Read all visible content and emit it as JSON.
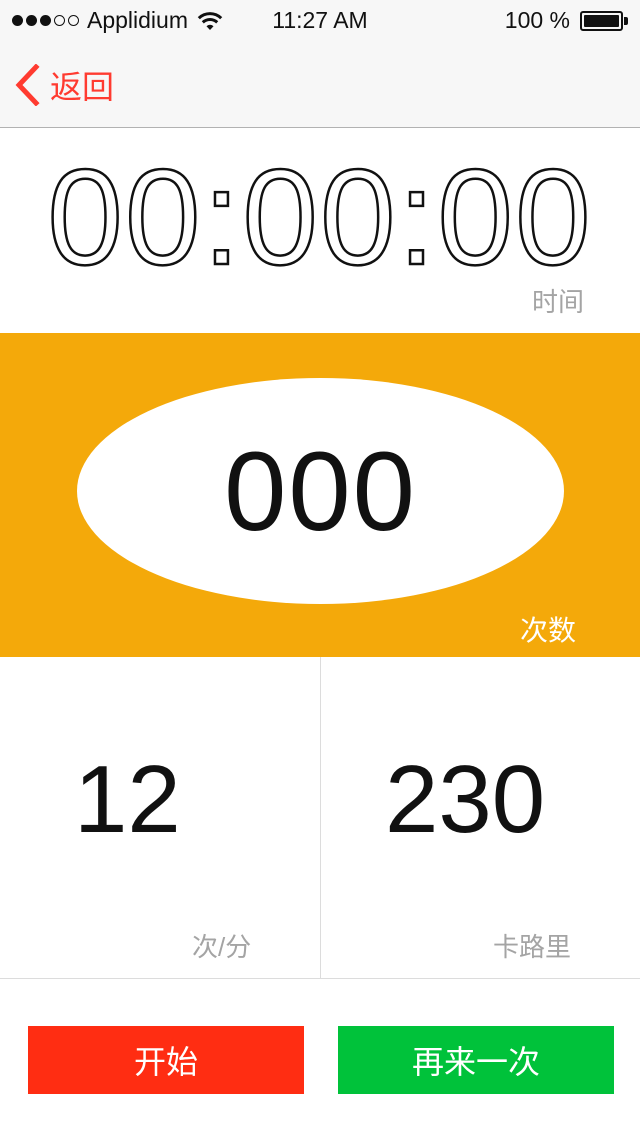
{
  "status_bar": {
    "carrier": "Applidium",
    "time": "11:27 AM",
    "battery": "100 %",
    "signal_strength": "3 of 5",
    "icons": [
      "signal-dots",
      "wifi-icon",
      "battery-icon"
    ]
  },
  "nav": {
    "back_label": "返回",
    "accent_color": "#ff3b30"
  },
  "timer": {
    "display": "00:00:00",
    "label": "时间"
  },
  "count": {
    "value": "000",
    "label": "次数",
    "panel_color": "#f4a90a"
  },
  "stats": {
    "rate_value": "12",
    "rate_label": "次/分",
    "calories_value": "230",
    "calories_label": "卡路里"
  },
  "buttons": {
    "start_label": "开始",
    "start_color": "#ff2d12",
    "restart_label": "再来一次",
    "restart_color": "#00c23a"
  }
}
